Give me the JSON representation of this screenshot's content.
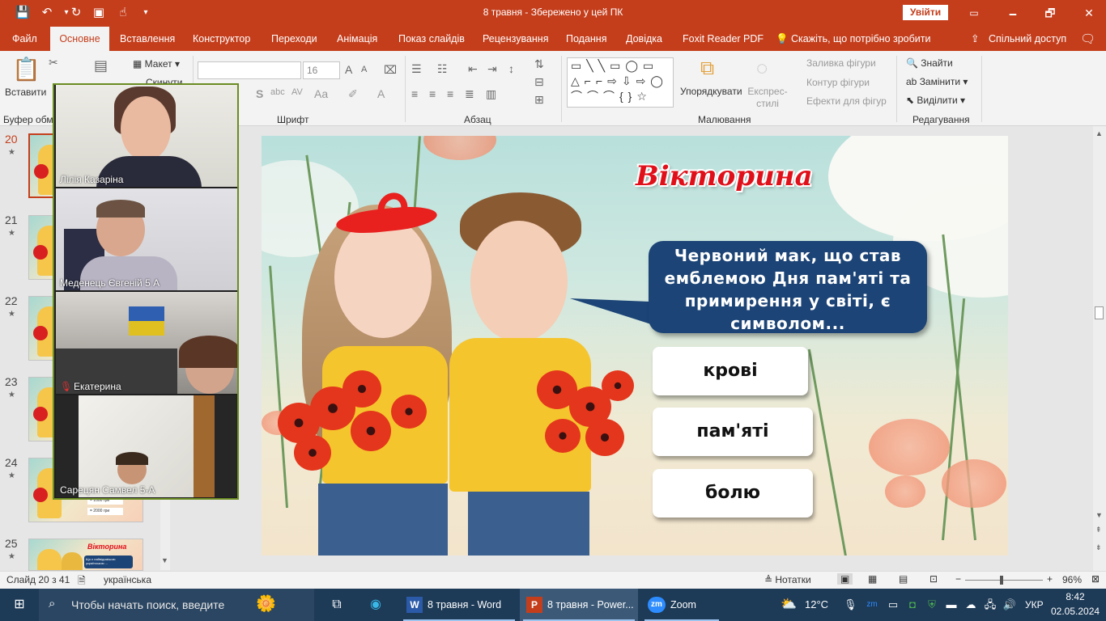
{
  "titlebar": {
    "doc_title": "8 травня  -  Збережено у цей ПК",
    "signin_label": "Увійти",
    "win_min": "🗕",
    "win_max": "🗗",
    "win_close": "✕"
  },
  "tabs": [
    "Файл",
    "Основне",
    "Вставлення",
    "Конструктор",
    "Переходи",
    "Анімація",
    "Показ слайдів",
    "Рецензування",
    "Подання",
    "Довідка",
    "Foxit Reader PDF",
    "Скажіть, що потрібно зробити",
    "Спільний доступ"
  ],
  "ribbon": {
    "paste": "Вставити",
    "clipboard": "Буфер обмі",
    "layout": "Макет",
    "reset": "Скинути",
    "font_size": "16",
    "font_group": "Шрифт",
    "paragraph_group": "Абзац",
    "drawing_group": "Малювання",
    "arrange": "Упорядкувати",
    "quick_styles": "Експрес-стилі",
    "shape_fill": "Заливка фігури",
    "shape_outline": "Контур фігури",
    "shape_effects": "Ефекти для фігур",
    "find": "Знайти",
    "replace": "Замінити",
    "select": "Виділити",
    "editing_group": "Редагування"
  },
  "thumbnails": [
    {
      "num": "20",
      "star": "★"
    },
    {
      "num": "21",
      "star": "★"
    },
    {
      "num": "22",
      "star": "★"
    },
    {
      "num": "23",
      "star": "★"
    },
    {
      "num": "24",
      "star": "★"
    },
    {
      "num": "25",
      "star": "★"
    }
  ],
  "thumb24_text": [
    "= 1000 гри",
    "= 2000 гри"
  ],
  "thumb25_title": "Вікторина",
  "thumb25_text": "Що є найвідомішою українською ...",
  "slide": {
    "title": "Вікторина",
    "question": "Червоний мак, що став емблемою Дня пам'яті та примирення у світі, є символом...",
    "answers": [
      "крові",
      "пам'яті",
      "болю"
    ]
  },
  "zoom": {
    "participants": [
      {
        "name": "Лілія Казаріна",
        "muted": false
      },
      {
        "name": "Меденець Євгеній 5 А",
        "muted": false
      },
      {
        "name": "Екатерина",
        "muted": true
      },
      {
        "name": "Сарецян Самвел 5-А",
        "muted": false
      }
    ]
  },
  "statusbar": {
    "slide_info": "Слайд 20 з 41",
    "language": "українська",
    "notes": "Нотатки",
    "zoom_level": "96%"
  },
  "taskbar": {
    "search_placeholder": "Чтобы начать поиск, введите",
    "apps": [
      "8 травня - Word",
      "8 травня - Power...",
      "Zoom"
    ],
    "weather": "12°C",
    "lang": "УКР",
    "time": "8:42",
    "date": "02.05.2024"
  },
  "colors": {
    "accent": "#c43e1c",
    "question_bg": "#1c4476",
    "title_red": "#e0101a",
    "taskbar": "#1d3a57"
  }
}
